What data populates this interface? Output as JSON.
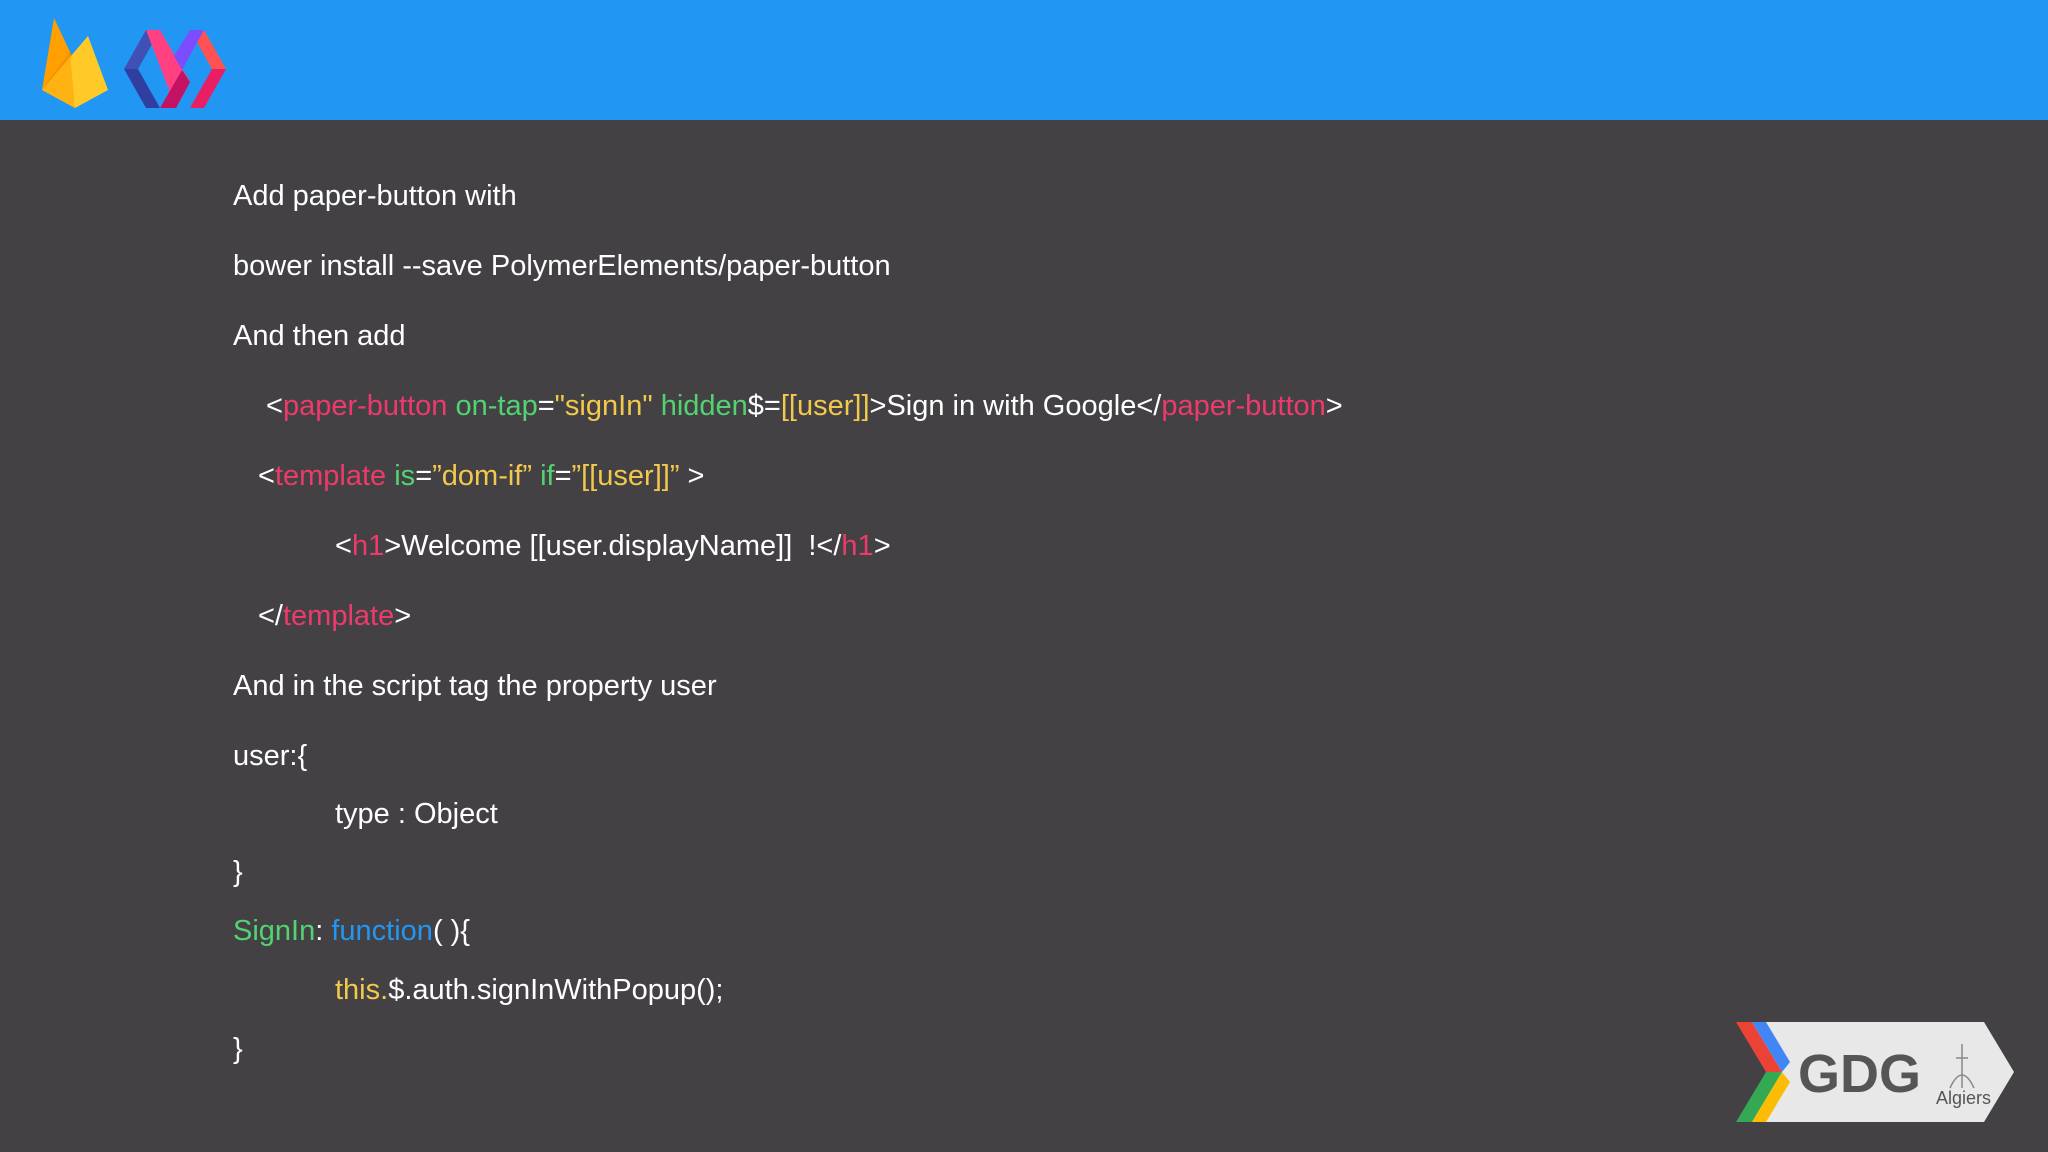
{
  "header": {
    "firebase_logo": "firebase-logo",
    "polymer_logo": "polymer-logo"
  },
  "slide": {
    "line1": "Add paper-button with",
    "line2": "bower install --save PolymerElements/paper-button",
    "line3": "And then add",
    "code1": {
      "lt": "<",
      "tag": "paper-button",
      "sp1": " ",
      "attr1": "on-tap",
      "eq1": "=",
      "val1": "\"signIn\"",
      "sp2": " ",
      "attr2": "hidden",
      "eq2": "$=",
      "val2": "[[user]]",
      "text": ">Sign in with Google</",
      "tag_close": "paper-button",
      "gt": ">"
    },
    "code2": {
      "lt": "<",
      "tag": "template",
      "sp1": " ",
      "attr1": "is",
      "eq1": "=",
      "val1": "”dom-if”",
      "sp2": " ",
      "attr2": "if",
      "eq2": "=",
      "val2": "”[[user]]”",
      "gt": " >"
    },
    "code3": {
      "lt": "<",
      "tag": "h1",
      "text": ">Welcome [[user.displayName]]  !</",
      "tag_close": "h1",
      "gt": ">"
    },
    "code4": {
      "lt": "</",
      "tag": "template",
      "gt": ">"
    },
    "line8": "And in the script tag the property user",
    "line9": "user:{",
    "line10": "type : Object",
    "line11": "}",
    "code12": {
      "name": "SignIn",
      "colon": ": ",
      "kw": "function",
      "rest": "( ){"
    },
    "code13": {
      "this": "this.",
      "rest": "$.auth.signInWithPopup();"
    },
    "line14": "}"
  },
  "badge": {
    "title": "GDG",
    "subtitle": "Algiers"
  }
}
